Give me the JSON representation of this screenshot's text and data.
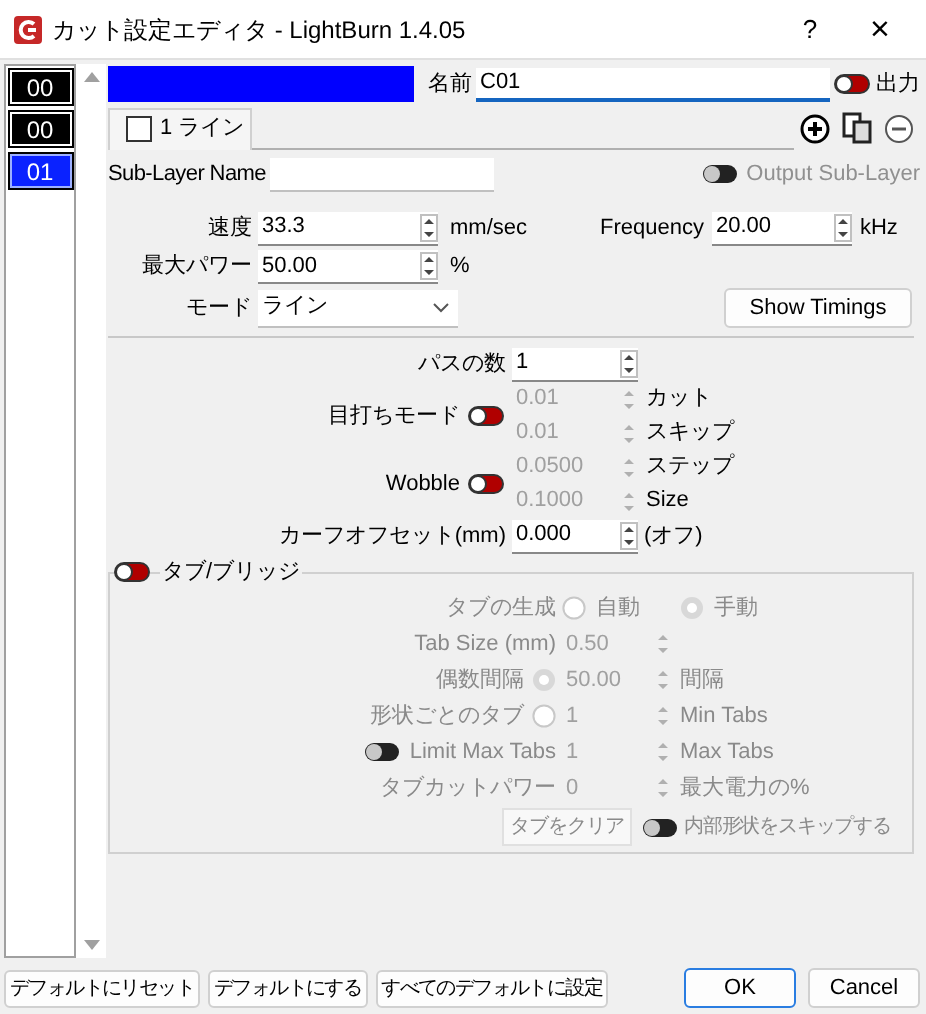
{
  "window": {
    "title": "カット設定エディタ - LightBurn 1.4.05",
    "help": "?",
    "close": "×"
  },
  "layers": [
    {
      "label": "00",
      "selected": false
    },
    {
      "label": "00",
      "selected": false
    },
    {
      "label": "01",
      "selected": true
    }
  ],
  "header": {
    "color": "#0000ff",
    "name_label": "名前",
    "name_value": "C01",
    "output_label": "出力",
    "output_on": false
  },
  "sublayer_tab": {
    "label": "1 ライン",
    "checked": false
  },
  "sublayer": {
    "label": "Sub-Layer Name",
    "output_label": "Output Sub-Layer",
    "output_on": false,
    "output_disabled": true
  },
  "speed": {
    "label": "速度",
    "value": "33.3",
    "unit": "mm/sec"
  },
  "frequency": {
    "label": "Frequency",
    "value": "20.00",
    "unit": "kHz"
  },
  "max_power": {
    "label": "最大パワー",
    "value": "50.00",
    "unit": "%"
  },
  "mode": {
    "label": "モード",
    "value": "ライン"
  },
  "show_timings": "Show Timings",
  "passes": {
    "label": "パスの数",
    "value": "1"
  },
  "perforation": {
    "label": "目打ちモード",
    "on": false,
    "fields": [
      {
        "value": "0.01",
        "unit": "カット",
        "disabled": true
      },
      {
        "value": "0.01",
        "unit": "スキップ",
        "disabled": true
      }
    ]
  },
  "wobble": {
    "label": "Wobble",
    "on": false,
    "fields": [
      {
        "value": "0.0500",
        "unit": "ステップ",
        "disabled": true
      },
      {
        "value": "0.1000",
        "unit": "Size",
        "disabled": true
      }
    ]
  },
  "kerf": {
    "label": "カーフオフセット(mm)",
    "value": "0.000",
    "unit": "(オフ)"
  },
  "tabs_group": {
    "label": "タブ/ブリッジ",
    "on": false,
    "disabled": true,
    "generation": {
      "label": "タブの生成",
      "options": [
        {
          "label": "自動",
          "selected": false
        },
        {
          "label": "手動",
          "selected": true
        }
      ]
    },
    "tab_size": {
      "label": "Tab Size (mm)",
      "value": "0.50"
    },
    "even_spacing": {
      "label": "偶数間隔",
      "selected": true,
      "value": "50.00",
      "unit": "間隔"
    },
    "per_shape": {
      "label": "形状ごとのタブ",
      "selected": false,
      "value": "1",
      "unit": "Min Tabs"
    },
    "limit_max": {
      "label": "Limit Max Tabs",
      "on": false,
      "value": "1",
      "unit": "Max Tabs"
    },
    "tab_cut_power": {
      "label": "タブカットパワー",
      "value": "0",
      "unit": "最大電力の%"
    },
    "clear_button": "タブをクリア",
    "skip_inner": {
      "label": "内部形状をスキップする",
      "on": false
    }
  },
  "footer_buttons": [
    "デフォルトにリセット",
    "デフォルトにする",
    "すべてのデフォルトに設定"
  ],
  "ok": "OK",
  "cancel": "Cancel"
}
